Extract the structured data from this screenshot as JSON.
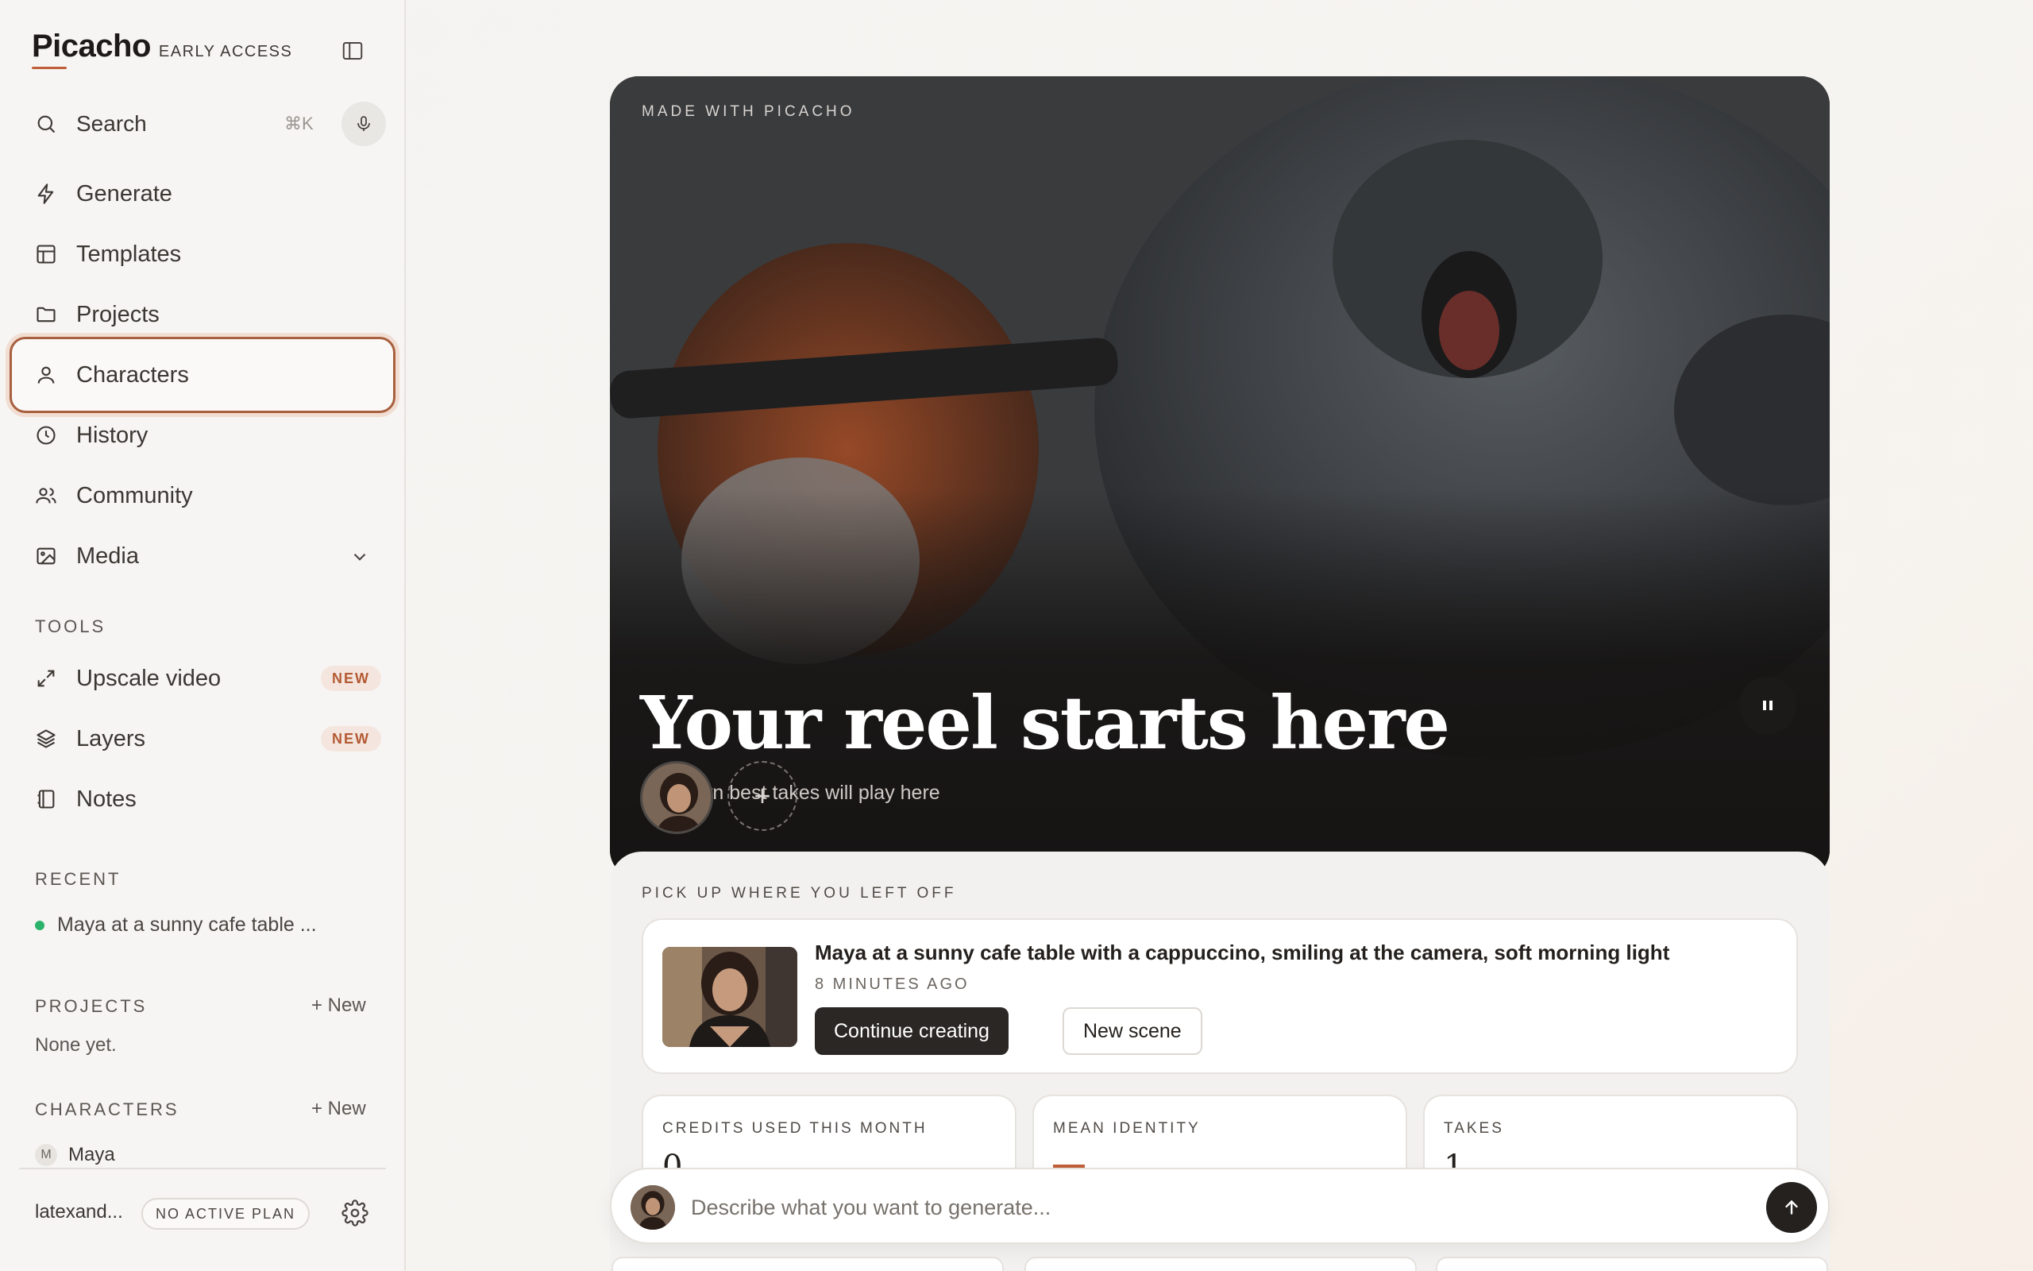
{
  "brand": {
    "name": "Picacho",
    "tag": "EARLY ACCESS"
  },
  "search": {
    "label": "Search",
    "shortcut": "⌘K"
  },
  "nav": [
    {
      "label": "Generate",
      "icon": "bolt-icon"
    },
    {
      "label": "Templates",
      "icon": "layout-icon"
    },
    {
      "label": "Projects",
      "icon": "folder-icon"
    },
    {
      "label": "Characters",
      "icon": "user-icon",
      "active": true
    },
    {
      "label": "History",
      "icon": "clock-icon"
    },
    {
      "label": "Community",
      "icon": "users-icon"
    },
    {
      "label": "Media",
      "icon": "image-icon"
    }
  ],
  "tools": {
    "heading": "TOOLS",
    "items": [
      {
        "label": "Upscale video",
        "badge": "NEW"
      },
      {
        "label": "Layers",
        "badge": "NEW"
      },
      {
        "label": "Notes"
      }
    ]
  },
  "recent": {
    "heading": "RECENT",
    "items": [
      {
        "label": "Maya at a sunny cafe table ..."
      }
    ]
  },
  "projects": {
    "heading": "PROJECTS",
    "new_label": "+ New",
    "empty": "None yet."
  },
  "characters": {
    "heading": "CHARACTERS",
    "new_label": "+ New",
    "items": [
      {
        "initial": "M",
        "name": "Maya"
      }
    ]
  },
  "user": {
    "name": "latexand...",
    "plan": "NO ACTIVE PLAN"
  },
  "hero": {
    "kicker": "MADE WITH PICACHO",
    "title": "Your reel starts here",
    "subtitle": "Your own best takes will play here",
    "add_label": "+"
  },
  "pickup": {
    "heading": "PICK UP WHERE YOU LEFT OFF",
    "title": "Maya at a sunny cafe table with a cappuccino, smiling at the camera, soft morning light",
    "time": "8 MINUTES AGO",
    "primary": "Continue creating",
    "secondary": "New scene"
  },
  "stats": [
    {
      "label": "CREDITS USED THIS MONTH",
      "value": "0"
    },
    {
      "label": "MEAN IDENTITY",
      "value": ""
    },
    {
      "label": "TAKES",
      "value": "1"
    }
  ],
  "prompt": {
    "placeholder": "Describe what you want to generate..."
  },
  "colors": {
    "accent": "#c0603a",
    "active_border": "#a8603e",
    "status_dot": "#2cb36b",
    "primary_button": "#2a2724"
  }
}
